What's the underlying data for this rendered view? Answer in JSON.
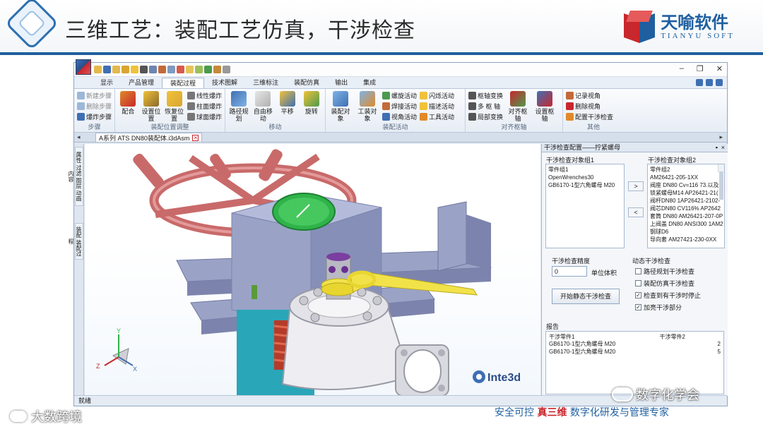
{
  "slide": {
    "title": "三维工艺：装配工艺仿真，干涉检查",
    "brand_cn": "天喻软件",
    "brand_en": "TIANYU SOFT",
    "footer_left": "大数跨境",
    "footer_slogan_pre": "安全可控",
    "footer_slogan_red": "真三维",
    "footer_slogan_post": "数字化研发与管理专家",
    "watermark": "数字化学会"
  },
  "app": {
    "menu_tabs": [
      "显示",
      "产品管理",
      "装配过程",
      "技术图解",
      "三维标注",
      "装配仿真",
      "输出",
      "集成"
    ],
    "active_tab": "装配过程",
    "ribbon": {
      "step": {
        "items": [
          "新建步骤",
          "删除步骤",
          "爆炸步骤"
        ],
        "label": "步骤"
      },
      "assembly_position": {
        "large": [
          "配合",
          "设置位置",
          "恢复位置"
        ],
        "small": [
          "线性爆炸",
          "柱面爆炸",
          "球面爆炸"
        ],
        "label": "装配位置调整"
      },
      "move": {
        "large": [
          "路径规划",
          "自由移动",
          "平移",
          "旋转"
        ],
        "label": "移动"
      },
      "assembly_animation": {
        "large": [
          "装配对象",
          "工装对象"
        ],
        "col1": [
          "螺旋活动",
          "焊接活动",
          "视角活动"
        ],
        "col2": [
          "闪烁活动",
          "描述活动",
          "工具活动"
        ],
        "label": "装配活动"
      },
      "align_axis": {
        "small": [
          "枢轴变换",
          "多 枢 轴",
          "局部变换"
        ],
        "large": [
          "对齐枢轴",
          "设置枢轴"
        ],
        "label": "对齐枢轴"
      },
      "other": {
        "items": [
          "记录视角",
          "删除视角",
          "配置干涉检查"
        ],
        "label": "其他"
      }
    },
    "document_tab": "A系列 ATS DN80装配体.i3dAsm",
    "left_tabs": [
      "属性  过滤  图层  动画内容",
      "装配  装配过程"
    ],
    "status": "就绪",
    "viewport_logo": "Inte3d",
    "axis_labels": {
      "x": "X",
      "y": "Y",
      "z": "Z"
    }
  },
  "panel": {
    "title": "干涉检查配置——拧紧螺母",
    "group1_label": "干涉检查对象组1",
    "group2_label": "干涉检查对象组2",
    "group1_items": [
      "零件组1",
      "OpenWrenches30",
      "GB6170-1型六角螺母 M20"
    ],
    "group2_items": [
      "零件组2",
      "AM26421-205-1XX",
      "阀座 DN80 Cv=116  73.以及",
      "锁紧螺母M14  AP26421-21(",
      "阀杆DN80  1AP26421-2102-",
      "阀芯DN80 CV116%  AP2642",
      "套筒 DN80 AM26421-207-0P",
      "上阀盖 DN80 ANSI300 1AM2",
      "钢球D6",
      "导向套  AM27421-230-0XX"
    ],
    "move_right": ">",
    "move_left": "<",
    "precision_label": "干涉检查精度",
    "precision_value": "0",
    "unit_label": "单位体积",
    "start_button": "开始静态干涉检查",
    "dynamic_label": "动态干涉检查",
    "checkboxes": [
      {
        "label": "路径规划干涉检查",
        "checked": false
      },
      {
        "label": "装配仿真干涉检查",
        "checked": false
      },
      {
        "label": "检查到有干涉时停止",
        "checked": true
      },
      {
        "label": "加亮干涉部分",
        "checked": true
      }
    ],
    "report_label": "报告",
    "report_headers": [
      "干涉零件1",
      "干涉零件2"
    ],
    "report_rows": [
      [
        "GB6170-1型六角螺母 M20",
        "2"
      ],
      [
        "GB6170-1型六角螺母 M20",
        "5"
      ]
    ]
  }
}
